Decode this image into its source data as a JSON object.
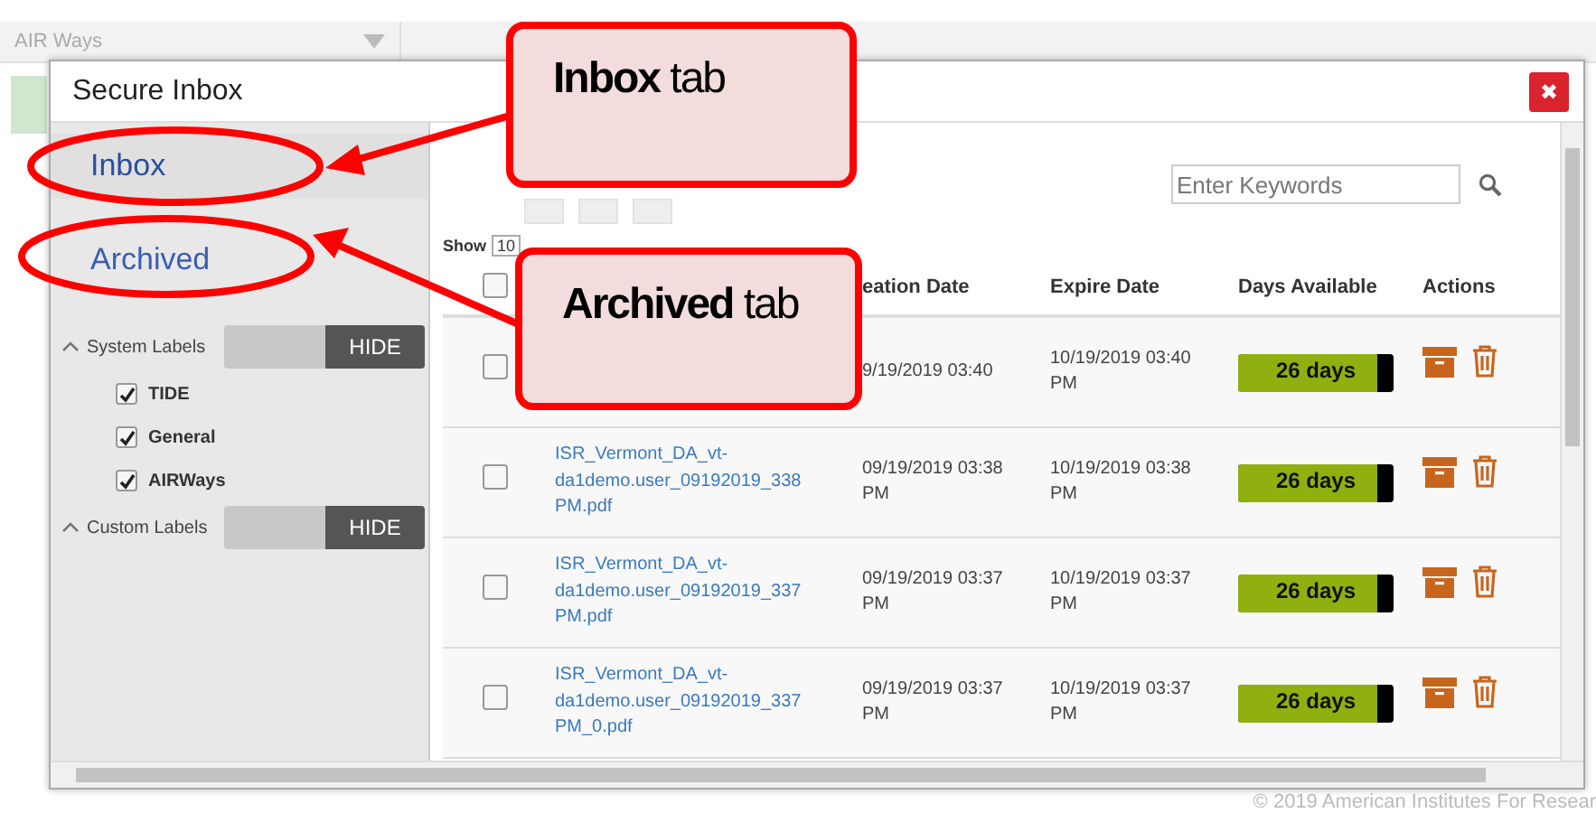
{
  "app_bar": {
    "dropdown": "AIR Ways"
  },
  "dialog": {
    "title": "Secure Inbox",
    "close": "✖"
  },
  "sidebar": {
    "tabs": [
      {
        "label": "Inbox",
        "selected": true
      },
      {
        "label": "Archived",
        "selected": false
      }
    ],
    "label_groups": [
      {
        "title": "System Labels",
        "toggle": "HIDE",
        "expanded": true,
        "items": [
          {
            "label": "TIDE",
            "checked": true
          },
          {
            "label": "General",
            "checked": true
          },
          {
            "label": "AIRWays",
            "checked": true
          }
        ]
      },
      {
        "title": "Custom Labels",
        "toggle": "HIDE",
        "expanded": true
      }
    ]
  },
  "search": {
    "placeholder": "Enter Keywords"
  },
  "show_entries": {
    "label": "Show",
    "value": "10"
  },
  "table": {
    "select_all": {
      "checked": false
    },
    "columns": [
      "",
      "eation Date",
      "Expire Date",
      "Days Available",
      "Actions"
    ],
    "rows": [
      {
        "checked": false,
        "file": "",
        "created": "9/19/2019 03:40",
        "expires": "10/19/2019 03:40 PM",
        "days": "26 days",
        "level": 0.89
      },
      {
        "checked": false,
        "file": "ISR_Vermont_DA_vt-da1demo.user_09192019_338 PM.pdf",
        "created": "09/19/2019 03:38 PM",
        "expires": "10/19/2019 03:38 PM",
        "days": "26 days",
        "level": 0.89
      },
      {
        "checked": false,
        "file": "ISR_Vermont_DA_vt-da1demo.user_09192019_337 PM.pdf",
        "created": "09/19/2019 03:37 PM",
        "expires": "10/19/2019 03:37 PM",
        "days": "26 days",
        "level": 0.89
      },
      {
        "checked": false,
        "file": "ISR_Vermont_DA_vt-da1demo.user_09192019_337 PM_0.pdf",
        "created": "09/19/2019 03:37 PM",
        "expires": "10/19/2019 03:37 PM",
        "days": "26 days",
        "level": 0.89
      }
    ]
  },
  "footer": "© 2019 American Institutes For Resear",
  "annotations": [
    {
      "text": "**Inbox** tab"
    },
    {
      "text": "**Archived** tab"
    }
  ]
}
